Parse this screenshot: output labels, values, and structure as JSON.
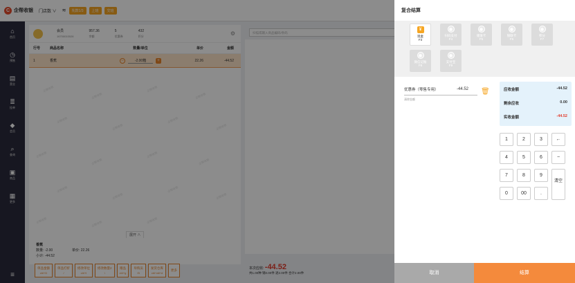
{
  "topbar": {
    "brand": "企帮收银",
    "store": "门店数 ∨",
    "buttons": [
      "先款1/3",
      "上班",
      "交班"
    ]
  },
  "sidebar": {
    "items": [
      {
        "icon": "home-icon",
        "glyph": "⌂",
        "label": "首页"
      },
      {
        "icon": "clock-icon",
        "glyph": "◷",
        "label": "预售"
      },
      {
        "icon": "report-icon",
        "glyph": "▤",
        "label": "营业"
      },
      {
        "icon": "list-icon",
        "glyph": "≣",
        "label": "挂单"
      },
      {
        "icon": "diamond-icon",
        "glyph": "◆",
        "label": "会员"
      },
      {
        "icon": "search-icon",
        "glyph": "⌕",
        "label": "查询"
      },
      {
        "icon": "bag-icon",
        "glyph": "▣",
        "label": "商品"
      },
      {
        "icon": "grid-icon",
        "glyph": "▦",
        "label": "更多"
      }
    ],
    "bottom_glyph": "≡"
  },
  "member": {
    "fields": [
      {
        "value": "会员",
        "key": "16700010026"
      },
      {
        "value": "957.36",
        "key": "余额"
      },
      {
        "value": "5",
        "key": "优惠券"
      },
      {
        "value": "432",
        "key": "积分"
      }
    ]
  },
  "cart": {
    "headers": [
      "行号",
      "商品名称",
      "数量/单位",
      "单价",
      "金额"
    ],
    "row": {
      "line": "1",
      "name": "香蕉",
      "qty": "-2.00箱",
      "price": "22.26",
      "amount": "-44.52"
    },
    "expand_label": "展开 ∧",
    "detail": {
      "name": "香蕉",
      "qty_label": "数量: -2.00",
      "price_label": "单价: 22.26",
      "extra": "小计: -44.52"
    }
  },
  "search": {
    "placeholder": "扫描或输入商品编码/条码"
  },
  "functions": [
    {
      "label": "单品金额",
      "key": "ctrl+D"
    },
    {
      "label": "单品打折",
      "key": "/"
    },
    {
      "label": "修改单位",
      "key": "ctrl+I"
    },
    {
      "label": "修改数量2",
      "key": "\\"
    },
    {
      "label": "赠品",
      "key": "ctrl+g"
    },
    {
      "label": "导购员",
      "key": "f3"
    },
    {
      "label": "发货仓库",
      "key": "ctrl+alt+d"
    },
    {
      "label": "更多",
      "key": ""
    }
  ],
  "totals": {
    "label": "本次应收:",
    "amount": "-44.52",
    "summary": "共1.00种 销0.00件 退2.00件 合计2.00件"
  },
  "payment": {
    "title": "复合结算",
    "methods": [
      {
        "name": "现金",
        "key": "F3",
        "icon": "cash-icon",
        "glyph": "¥",
        "active": true
      },
      {
        "name": "扫码支付",
        "key": "F4",
        "icon": "scan-icon",
        "glyph": "◉",
        "active": false
      },
      {
        "name": "储值卡",
        "key": "F5",
        "icon": "card-icon",
        "glyph": "◉",
        "active": false
      },
      {
        "name": "银联卡",
        "key": "F6",
        "icon": "bank-icon",
        "glyph": "◉",
        "active": false
      },
      {
        "name": "积分",
        "key": "F7",
        "icon": "points-icon",
        "glyph": "◉",
        "active": false
      },
      {
        "name": "微信记账",
        "key": "F8",
        "icon": "wechat-icon",
        "glyph": "◉",
        "active": false
      },
      {
        "name": "支付宝",
        "key": "F9",
        "icon": "alipay-icon",
        "glyph": "◉",
        "active": false
      }
    ],
    "coupon": {
      "name": "优惠券（零售专用）",
      "amount": "-44.52",
      "clear": "清除金额"
    },
    "summary": {
      "receivable_label": "应收金额",
      "receivable": "-44.52",
      "remaining_label": "剩余应收",
      "remaining": "0.00",
      "received_label": "实收金额",
      "received": "-44.52"
    },
    "keypad": [
      "1",
      "2",
      "3",
      "←",
      "4",
      "5",
      "6",
      "−",
      "7",
      "8",
      "9",
      "清空",
      "0",
      "00",
      "."
    ],
    "cancel": "取消",
    "confirm": "结算",
    "colors": {
      "accent": "#f48a3c",
      "red": "#e23b2c",
      "summary_bg": "#e4f2fb"
    }
  }
}
